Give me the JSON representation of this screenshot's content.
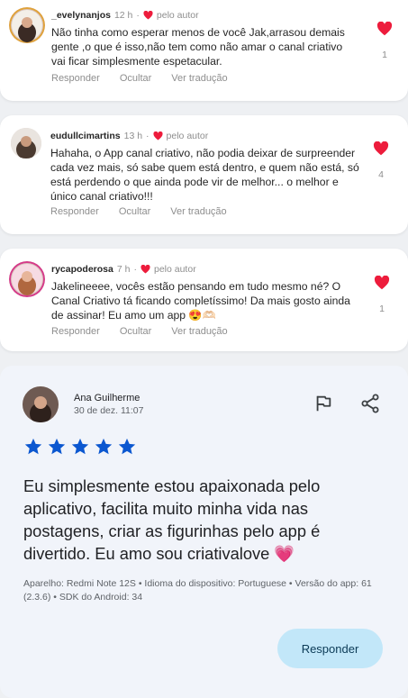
{
  "comments": [
    {
      "username": "_evelynanjos",
      "time": "12 h",
      "separator": "·",
      "author_badge": "pelo autor",
      "text": "Não tinha como esperar menos de você Jak,arrasou demais gente ,o que é isso,não tem como não amar o canal criativo vai ficar simplesmente espetacular.",
      "actions": [
        "Responder",
        "Ocultar",
        "Ver tradução"
      ],
      "likes": "1"
    },
    {
      "username": "eudullcimartins",
      "time": "13 h",
      "separator": "·",
      "author_badge": "pelo autor",
      "text": "Hahaha, o App canal criativo, não podia deixar de surpreender cada vez mais, só sabe quem está dentro, e quem não está, só está perdendo o que ainda pode vir de melhor... o melhor e único canal criativo!!!",
      "actions": [
        "Responder",
        "Ocultar",
        "Ver tradução"
      ],
      "likes": "4"
    },
    {
      "username": "rycapoderosa",
      "time": "7 h",
      "separator": "·",
      "author_badge": "pelo autor",
      "text": "Jakelineeee, vocês estão pensando em tudo mesmo né? O Canal Criativo tá ficando completíssimo! Da mais gosto ainda de assinar! Eu amo um app 😍🫶🏻",
      "actions": [
        "Responder",
        "Ocultar",
        "Ver tradução"
      ],
      "likes": "1"
    }
  ],
  "review": {
    "name": "Ana Guilherme",
    "date": "30 de dez. 11:07",
    "rating": 5,
    "text": "Eu simplesmente estou apaixonada pelo aplicativo, facilita muito minha vida nas postagens, criar as figurinhas pelo app é divertido. Eu amo sou criativalove 💗",
    "info": "Aparelho: Redmi Note 12S • Idioma do dispositivo: Portuguese • Versão do app: 61 (2.3.6) • SDK do Android: 34",
    "reply_label": "Responder",
    "icons": [
      "flag-icon",
      "share-icon"
    ]
  },
  "colors": {
    "heart": "#ed1c3c",
    "star": "#0b57d0",
    "reply_button_bg": "#c2e7f9",
    "review_bg": "#f1f4fa"
  }
}
